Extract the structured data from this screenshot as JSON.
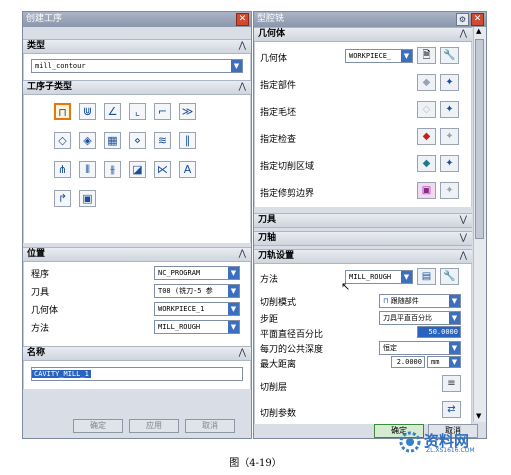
{
  "left_dialog": {
    "title": "创建工序",
    "sections": {
      "type": "类型",
      "subtype": "工序子类型",
      "position": "位置",
      "name": "名称"
    },
    "type_value": "mill_contour",
    "position_rows": [
      {
        "label": "程序",
        "value": "NC_PROGRAM"
      },
      {
        "label": "刀具",
        "value": "T08 (铣刀-5 参"
      },
      {
        "label": "几何体",
        "value": "WORKPIECE_1"
      },
      {
        "label": "方法",
        "value": "MILL_ROUGH"
      }
    ],
    "name_value": "CAVITY_MILL_1",
    "buttons": {
      "ok": "确定",
      "apply": "应用",
      "cancel": "取消"
    }
  },
  "right_dialog": {
    "title": "型腔铣",
    "sections": {
      "geometry": "几何体",
      "tool": "刀具",
      "axis": "刀轴",
      "path": "刀轨设置"
    },
    "geometry_label": "几何体",
    "geometry_value": "WORKPIECE_",
    "geometry_rows": [
      "指定部件",
      "指定毛坯",
      "指定检查",
      "指定切削区域",
      "指定修剪边界"
    ],
    "method_label": "方法",
    "method_value": "MILL_ROUGH",
    "path_rows": [
      {
        "label": "切削模式",
        "value": "跟随部件"
      },
      {
        "label": "步距",
        "value": "刀具平直百分比"
      },
      {
        "label": "平面直径百分比",
        "value": "50.0000"
      },
      {
        "label": "每刀的公共深度",
        "value": "恒定"
      },
      {
        "label": "最大距离",
        "value": "2.0000",
        "unit": "mm"
      },
      {
        "label": "切削层",
        "value": ""
      },
      {
        "label": "切削参数",
        "value": ""
      }
    ],
    "buttons": {
      "ok": "确定",
      "cancel": "取消"
    }
  },
  "caption": "图（4-19）",
  "watermark": {
    "brand": "资料网",
    "url": "ZL.XS1616.COM"
  },
  "colors": {
    "accent": "#3d6fbf",
    "selection": "#e07a10",
    "close": "#d04a2f"
  }
}
